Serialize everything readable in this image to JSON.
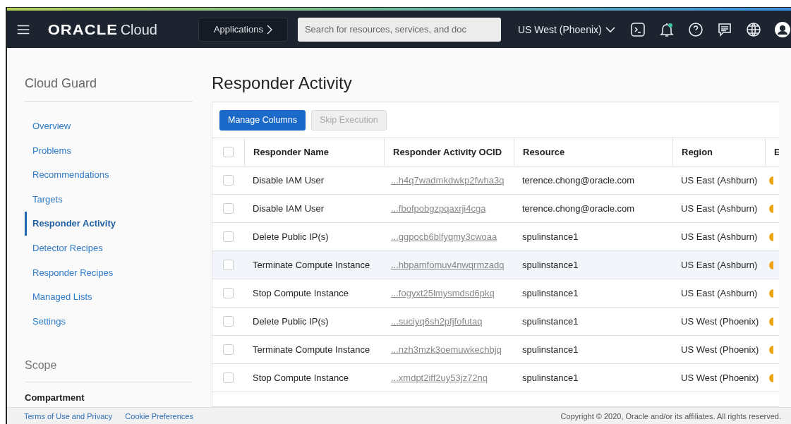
{
  "header": {
    "logo": {
      "wordmark": "ORACLE",
      "product": "Cloud"
    },
    "applications_button": "Applications",
    "search": {
      "placeholder": "Search for resources, services, and doc"
    },
    "region": "US West (Phoenix)",
    "notifications_unread": true
  },
  "sidebar": {
    "title": "Cloud Guard",
    "items": [
      {
        "label": "Overview",
        "selected": false
      },
      {
        "label": "Problems",
        "selected": false
      },
      {
        "label": "Recommendations",
        "selected": false
      },
      {
        "label": "Targets",
        "selected": false
      },
      {
        "label": "Responder Activity",
        "selected": true
      },
      {
        "label": "Detector Recipes",
        "selected": false
      },
      {
        "label": "Responder Recipes",
        "selected": false
      },
      {
        "label": "Managed Lists",
        "selected": false
      },
      {
        "label": "Settings",
        "selected": false
      }
    ],
    "scope_title": "Scope",
    "compartment_label": "Compartment"
  },
  "page_title": "Responder Activity",
  "toolbar": [
    {
      "label": "Manage Columns",
      "disabled": false
    },
    {
      "label": "Skip Execution",
      "disabled": true
    }
  ],
  "table": {
    "select_all_checked": false,
    "columns": [
      "Responder Name",
      "Responder Activity OCID",
      "Resource",
      "Region",
      "E"
    ],
    "rows": [
      {
        "checked": false,
        "highlighted": false,
        "name": "Disable IAM User",
        "ocid": "...h4q7wadmkdwkp2fwha3q",
        "resource": "terence.chong@oracle.com",
        "region": "US East (Ashburn)"
      },
      {
        "checked": false,
        "highlighted": false,
        "name": "Disable IAM User",
        "ocid": "...fbofpobgzpqaxrji4cga",
        "resource": "terence.chong@oracle.com",
        "region": "US East (Ashburn)"
      },
      {
        "checked": false,
        "highlighted": false,
        "name": "Delete Public IP(s)",
        "ocid": "...ggpocb6blfyqmy3cwoaa",
        "resource": "spulinstance1",
        "region": "US East (Ashburn)"
      },
      {
        "checked": false,
        "highlighted": true,
        "name": "Terminate Compute Instance",
        "ocid": "...hbpamfomuv4nwqrmzadq",
        "resource": "spulinstance1",
        "region": "US East (Ashburn)"
      },
      {
        "checked": false,
        "highlighted": false,
        "name": "Stop Compute Instance",
        "ocid": "...fogyxt25lmysmdsd6pkq",
        "resource": "spulinstance1",
        "region": "US East (Ashburn)"
      },
      {
        "checked": false,
        "highlighted": false,
        "name": "Delete Public IP(s)",
        "ocid": "...suciyq6sh2pfjfofutaq",
        "resource": "spulinstance1",
        "region": "US West (Phoenix)"
      },
      {
        "checked": false,
        "highlighted": false,
        "name": "Terminate Compute Instance",
        "ocid": "...nzh3mzk3oemuwkechbjq",
        "resource": "spulinstance1",
        "region": "US West (Phoenix)"
      },
      {
        "checked": false,
        "highlighted": false,
        "name": "Stop Compute Instance",
        "ocid": "...xmdpt2iff2uy53jz72nq",
        "resource": "spulinstance1",
        "region": "US West (Phoenix)"
      }
    ]
  },
  "footer": {
    "links": [
      "Terms of Use and Privacy",
      "Cookie Preferences"
    ],
    "copyright": "Copyright © 2020, Oracle and/or its affiliates. All rights reserved."
  }
}
